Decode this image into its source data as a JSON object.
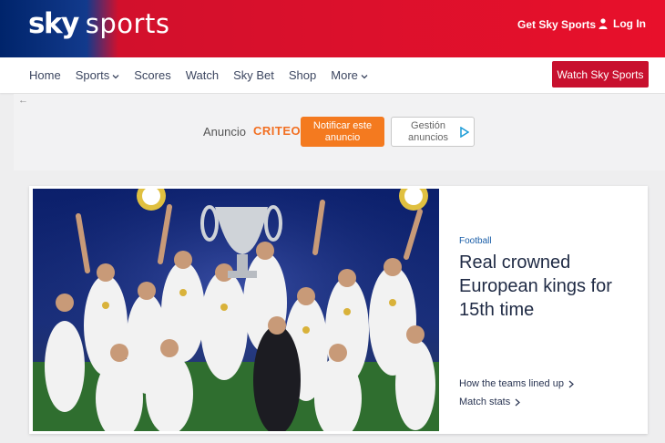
{
  "header": {
    "logo_sky": "sky",
    "logo_sports": "sports",
    "get_sky_sports": "Get Sky Sports",
    "login": "Log In",
    "colors": {
      "brand_blue": "#00246b",
      "brand_red": "#e8102b"
    }
  },
  "nav": {
    "items": [
      {
        "label": "Home"
      },
      {
        "label": "Sports",
        "has_dropdown": true
      },
      {
        "label": "Scores"
      },
      {
        "label": "Watch"
      },
      {
        "label": "Sky Bet"
      },
      {
        "label": "Shop"
      },
      {
        "label": "More",
        "has_dropdown": true
      }
    ],
    "cta": "Watch Sky Sports"
  },
  "ad": {
    "back_icon": "back-arrow-icon",
    "label": "Anuncio",
    "brand": "CRITEO",
    "notify_button": "Notificar este anuncio",
    "manage_button": "Gestión anuncios",
    "colors": {
      "notify": "#f47a1f"
    }
  },
  "article": {
    "category": "Football",
    "headline": "Real crowned European kings for 15th time",
    "links": [
      {
        "label": "How the teams lined up"
      },
      {
        "label": "Match stats"
      }
    ]
  }
}
